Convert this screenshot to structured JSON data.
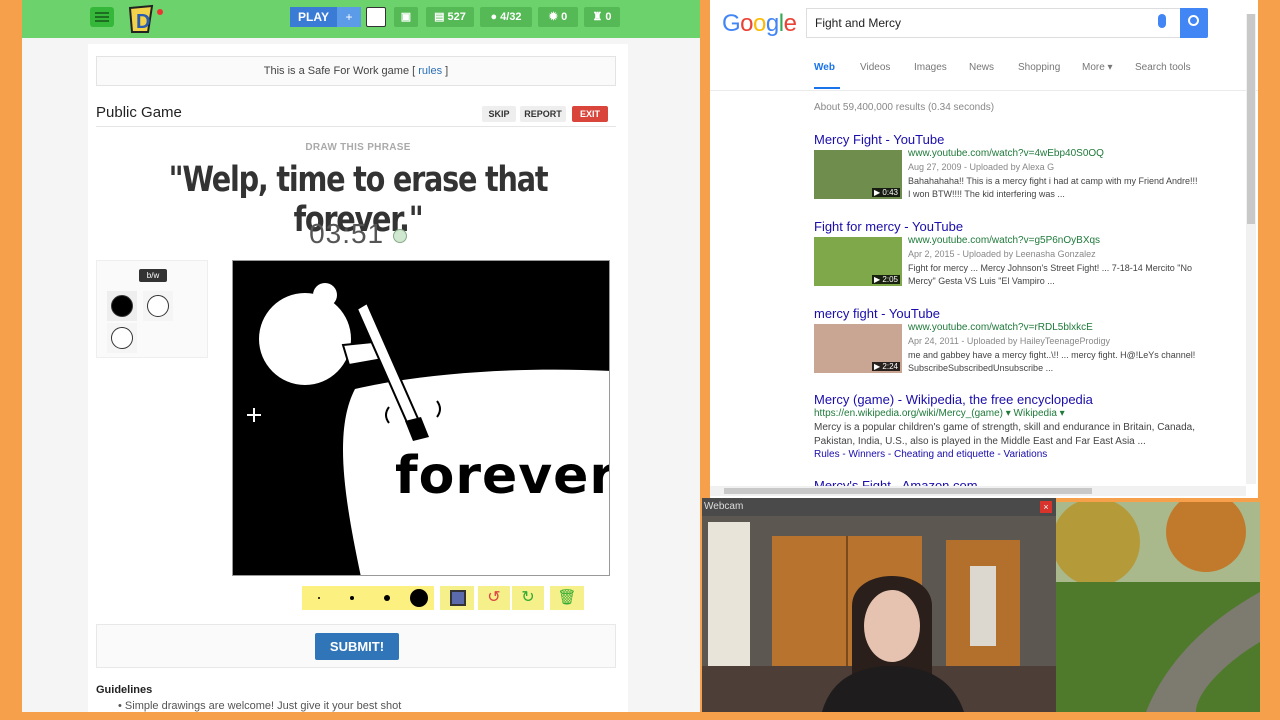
{
  "game": {
    "nav": {
      "play": "PLAY",
      "plus": "+",
      "coins": "527",
      "players": "4/32",
      "stars": "0",
      "trophies": "0"
    },
    "sfw": {
      "text": "This is a Safe For Work game [ ",
      "link": "rules",
      "end": " ]"
    },
    "title": "Public Game",
    "buttons": {
      "skip": "SKIP",
      "report": "REPORT",
      "exit": "EXIT"
    },
    "hint": "DRAW THIS PHRASE",
    "phrase": "\"Welp, time to erase that forever.\"",
    "timer": "03:51",
    "palette": {
      "label": "b/w"
    },
    "drawing_text": "forever",
    "submit": "SUBMIT!",
    "guidelines_title": "Guidelines",
    "guideline_1": "Simple drawings are welcome! Just give it your best shot"
  },
  "google": {
    "query": "Fight and Mercy",
    "tabs": [
      "Web",
      "Videos",
      "Images",
      "News",
      "Shopping",
      "More ▾",
      "Search tools"
    ],
    "result_count": "About 59,400,000 results (0.34 seconds)",
    "results": [
      {
        "title": "Mercy Fight - YouTube",
        "url": "www.youtube.com/watch?v=4wEbp40S0OQ",
        "meta": "Aug 27, 2009 - Uploaded by Alexa G",
        "snippet": "Bahahahaha!! This is a mercy fight i had at camp with my Friend Andre!!! I won BTW!!!! The kid interfering was ...",
        "duration": "▶ 0:43"
      },
      {
        "title": "Fight for mercy - YouTube",
        "url": "www.youtube.com/watch?v=g5P6nOyBXqs",
        "meta": "Apr 2, 2015 - Uploaded by Leenasha Gonzalez",
        "snippet": "Fight for mercy ... Mercy Johnson's Street Fight! ... 7-18-14 Mercito \"No Mercy\" Gesta VS Luis \"El Vampiro ...",
        "duration": "▶ 2:05"
      },
      {
        "title": "mercy fight - YouTube",
        "url": "www.youtube.com/watch?v=rRDL5blxkcE",
        "meta": "Apr 24, 2011 - Uploaded by HaileyTeenageProdigy",
        "snippet": "me and gabbey have a mercy fight..\\!! ... mercy fight. H@!LeYs channel! SubscribeSubscribedUnsubscribe ...",
        "duration": "▶ 2:24"
      }
    ],
    "wiki": {
      "title": "Mercy (game) - Wikipedia, the free encyclopedia",
      "url": "https://en.wikipedia.org/wiki/Mercy_(game) ▾ Wikipedia ▾",
      "snippet": "Mercy is a popular children's game of strength, skill and endurance in Britain, Canada, Pakistan, India, U.S., also is played in the Middle East and Far East Asia ...",
      "links": "Rules - Winners - Cheating and etiquette - Variations"
    },
    "next_title": "Mercy's Fight - Amazon.com"
  },
  "webcam": {
    "title": "Webcam",
    "close": "×"
  },
  "colors": {
    "green_bar": "#6cd26b",
    "play_blue": "#3a7bd5",
    "exit_red": "#d9453b",
    "google_blue": "#4285f4",
    "link": "#1a0dab",
    "url_green": "#1f7a3a"
  }
}
